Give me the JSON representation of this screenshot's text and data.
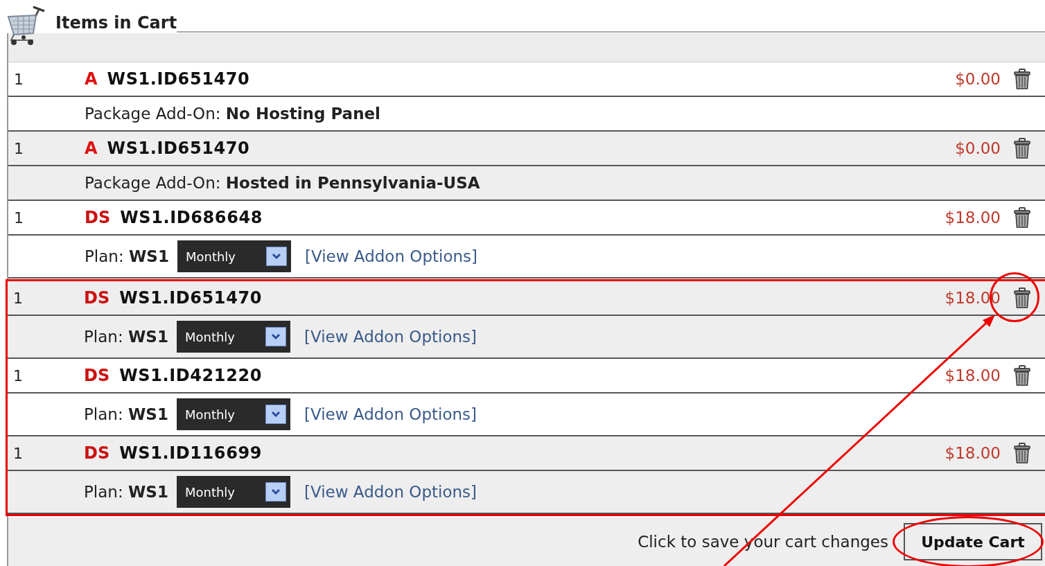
{
  "title": "Items in Cart",
  "items": [
    {
      "qty": "1",
      "type": "A",
      "code": "WS1.ID651470",
      "price": "$0.00",
      "highlighted": false,
      "circled": false,
      "detail": {
        "kind": "addon",
        "label": "Package Add-On:",
        "value": "No Hosting Panel"
      }
    },
    {
      "qty": "1",
      "type": "A",
      "code": "WS1.ID651470",
      "price": "$0.00",
      "highlighted": false,
      "circled": false,
      "detail": {
        "kind": "addon",
        "label": "Package Add-On:",
        "value": "Hosted in Pennsylvania-USA"
      }
    },
    {
      "qty": "1",
      "type": "DS",
      "code": "WS1.ID686648",
      "price": "$18.00",
      "highlighted": false,
      "circled": false,
      "detail": {
        "kind": "plan",
        "label": "Plan:",
        "value": "WS1",
        "billing": "Monthly",
        "link": "[View Addon Options]"
      }
    },
    {
      "qty": "1",
      "type": "DS",
      "code": "WS1.ID651470",
      "price": "$18.00",
      "highlighted": true,
      "circled": true,
      "detail": {
        "kind": "plan",
        "label": "Plan:",
        "value": "WS1",
        "billing": "Monthly",
        "link": "[View Addon Options]"
      }
    },
    {
      "qty": "1",
      "type": "DS",
      "code": "WS1.ID421220",
      "price": "$18.00",
      "highlighted": true,
      "circled": false,
      "detail": {
        "kind": "plan",
        "label": "Plan:",
        "value": "WS1",
        "billing": "Monthly",
        "link": "[View Addon Options]"
      }
    },
    {
      "qty": "1",
      "type": "DS",
      "code": "WS1.ID116699",
      "price": "$18.00",
      "highlighted": true,
      "circled": false,
      "detail": {
        "kind": "plan",
        "label": "Plan:",
        "value": "WS1",
        "billing": "Monthly",
        "link": "[View Addon Options]"
      }
    }
  ],
  "footer": {
    "hint": "Click to save your cart changes",
    "button": "Update Cart",
    "button_circled": true
  }
}
